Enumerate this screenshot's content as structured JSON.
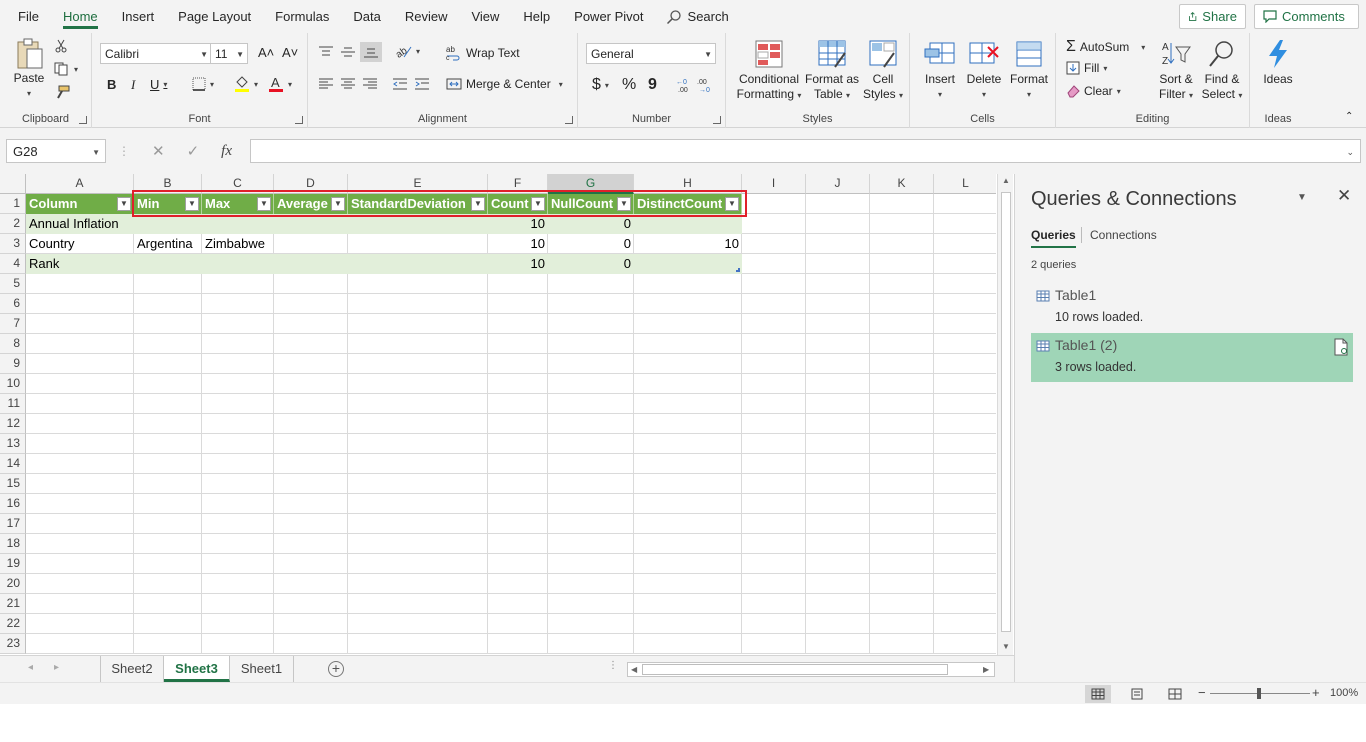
{
  "menu": {
    "tabs": [
      "File",
      "Home",
      "Insert",
      "Page Layout",
      "Formulas",
      "Data",
      "Review",
      "View",
      "Help",
      "Power Pivot"
    ],
    "active_tab": "Home",
    "search_label": "Search",
    "share_label": "Share",
    "comments_label": "Comments"
  },
  "ribbon": {
    "clipboard": {
      "label": "Clipboard",
      "paste": "Paste"
    },
    "font": {
      "label": "Font",
      "name": "Calibri",
      "size": "11",
      "bold": "B",
      "italic": "I",
      "underline": "U"
    },
    "alignment": {
      "label": "Alignment",
      "wrap_text": "Wrap Text",
      "merge_center": "Merge & Center"
    },
    "number": {
      "label": "Number",
      "format": "General",
      "currency": "$",
      "percent": "%",
      "comma": "9"
    },
    "styles": {
      "label": "Styles",
      "conditional_formatting_1": "Conditional",
      "conditional_formatting_2": "Formatting",
      "format_table_1": "Format as",
      "format_table_2": "Table",
      "cell_styles_1": "Cell",
      "cell_styles_2": "Styles"
    },
    "cells": {
      "label": "Cells",
      "insert": "Insert",
      "delete": "Delete",
      "format": "Format"
    },
    "editing": {
      "label": "Editing",
      "autosum": "AutoSum",
      "fill": "Fill",
      "clear": "Clear",
      "sort_filter_1": "Sort &",
      "sort_filter_2": "Filter",
      "find_select_1": "Find &",
      "find_select_2": "Select"
    },
    "ideas": {
      "label": "Ideas",
      "button": "Ideas"
    }
  },
  "formula_bar": {
    "name_box": "G28",
    "fx": "fx",
    "formula": ""
  },
  "grid": {
    "columns": [
      "A",
      "B",
      "C",
      "D",
      "E",
      "F",
      "G",
      "H",
      "I",
      "J",
      "K",
      "L"
    ],
    "selected_column": "G",
    "rows": [
      "1",
      "2",
      "3",
      "4",
      "5",
      "6",
      "7",
      "8",
      "9",
      "10",
      "11",
      "12",
      "13",
      "14",
      "15",
      "16",
      "17",
      "18",
      "19",
      "20",
      "21",
      "22",
      "23"
    ],
    "table_headers": [
      "Column",
      "Min",
      "Max",
      "Average",
      "StandardDeviation",
      "Count",
      "NullCount",
      "DistinctCount"
    ],
    "table_rows": [
      [
        "Annual Inflation",
        "",
        "",
        "",
        "",
        "10",
        "0",
        ""
      ],
      [
        "Country",
        "Argentina",
        "Zimbabwe",
        "",
        "",
        "10",
        "0",
        "10"
      ],
      [
        "Rank",
        "",
        "",
        "",
        "",
        "10",
        "0",
        ""
      ]
    ]
  },
  "sheets": {
    "tabs": [
      "Sheet2",
      "Sheet3",
      "Sheet1"
    ],
    "active": "Sheet3"
  },
  "status": {
    "zoom": "100%"
  },
  "queries_pane": {
    "title": "Queries & Connections",
    "tab_queries": "Queries",
    "tab_connections": "Connections",
    "count_text": "2 queries",
    "items": [
      {
        "name": "Table1",
        "status": "10 rows loaded."
      },
      {
        "name": "Table1 (2)",
        "status": "3 rows loaded."
      }
    ]
  },
  "colors": {
    "accent": "#217346",
    "table_header": "#70ad47",
    "table_band": "#e2efda",
    "highlight_box": "#e0202a",
    "query_selected": "#9fd5b7"
  }
}
